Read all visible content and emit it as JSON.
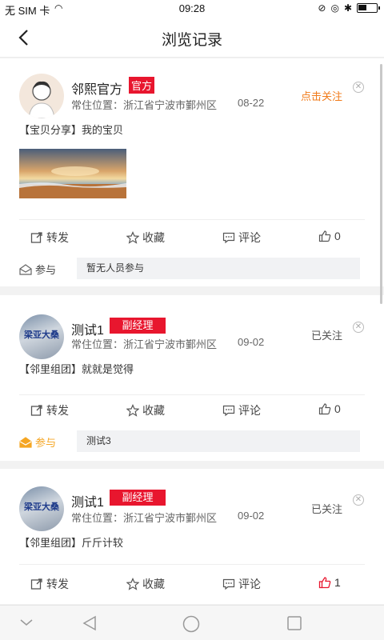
{
  "status": {
    "carrier": "无 SIM 卡",
    "time": "09:28"
  },
  "header": {
    "title": "浏览记录"
  },
  "actions": {
    "forward": "转发",
    "favorite": "收藏",
    "comment": "评论"
  },
  "join_label": "参与",
  "posts": [
    {
      "name": "邻熙官方",
      "tag": "官方",
      "location": "常住位置：浙江省宁波市鄞州区",
      "date": "08-22",
      "follow": "点击关注",
      "content": "【宝贝分享】我的宝贝",
      "likes": "0",
      "participants": "暂无人员参与"
    },
    {
      "name": "测试1",
      "tag": "副经理",
      "avatar_text": "梁亚大桑",
      "location": "常住位置：浙江省宁波市鄞州区",
      "date": "09-02",
      "follow": "已关注",
      "content": "【邻里组团】就就是觉得",
      "likes": "0",
      "participants": "测试3"
    },
    {
      "name": "测试1",
      "tag": "副经理",
      "avatar_text": "梁亚大桑",
      "location": "常住位置：浙江省宁波市鄞州区",
      "date": "09-02",
      "follow": "已关注",
      "content": "【邻里组团】斤斤计较",
      "likes": "1"
    }
  ],
  "colors": {
    "accent_red": "#e8162e",
    "follow_orange": "#f17b1a",
    "join_orange": "#f5a623",
    "like_red": "#e8162e"
  }
}
